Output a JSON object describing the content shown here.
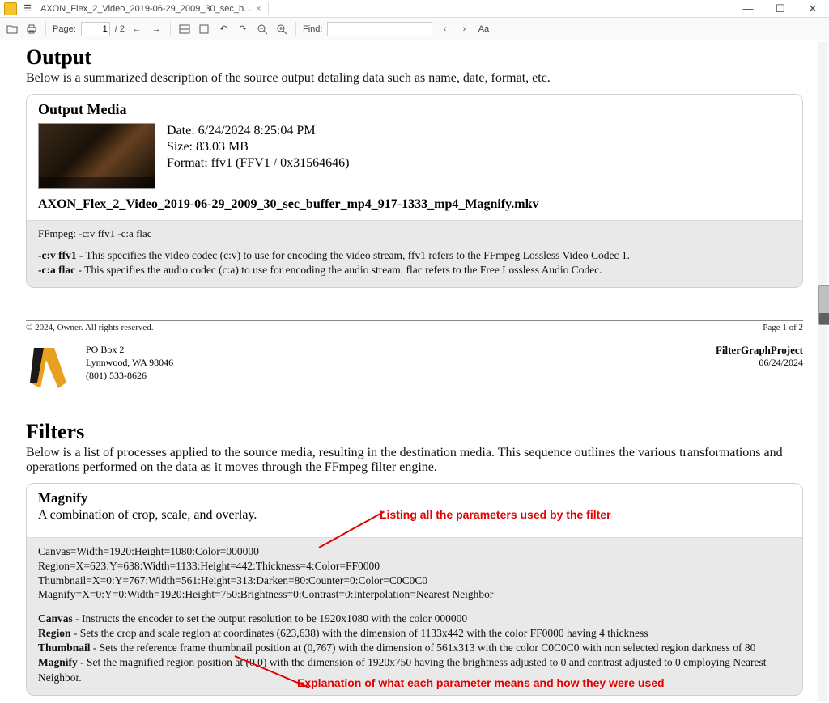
{
  "window": {
    "tab_title": "AXON_Flex_2_Video_2019-06-29_2009_30_sec_b…",
    "minimize": "—",
    "maximize": "☐",
    "close": "✕"
  },
  "toolbar": {
    "page_label": "Page:",
    "page_value": "1",
    "page_total": "/ 2",
    "find_label": "Find:",
    "find_value": ""
  },
  "output": {
    "heading": "Output",
    "sub": "Below is a summarized description of the source output detaling data such as name, date, format, etc.",
    "panel_title": "Output Media",
    "date": "Date: 6/24/2024 8:25:04 PM",
    "size": "Size: 83.03 MB",
    "format": "Format: ffv1 (FFV1 / 0x31564646)",
    "filename": "AXON_Flex_2_Video_2019-06-29_2009_30_sec_buffer_mp4_917-1333_mp4_Magnify.mkv",
    "ffmpeg": "FFmpeg: -c:v ffv1 -c:a flac",
    "expl_cv_b": "-c:v ffv1",
    "expl_cv_t": " - This specifies the video codec (c:v) to use for encoding the video stream, ffv1 refers to the FFmpeg Lossless Video Codec 1.",
    "expl_ca_b": "-c:a flac",
    "expl_ca_t": " - This specifies the audio codec (c:a) to use for encoding the audio stream. flac refers to the Free Lossless Audio Codec."
  },
  "footer": {
    "copyright": "© 2024, Owner. All rights reserved.",
    "page": "Page 1 of 2"
  },
  "header2": {
    "addr1": "PO Box 2",
    "addr2": "Lynnwood, WA 98046",
    "addr3": "(801) 533-8626",
    "project": "FilterGraphProject",
    "date": "06/24/2024"
  },
  "filters": {
    "heading": "Filters",
    "sub": "Below is a list of processes applied to the source media, resulting in the destination media. This sequence outlines the various transformations and operations performed on the data as it moves through the FFmpeg filter engine.",
    "panel_title": "Magnify",
    "panel_sub": "A combination of crop, scale, and overlay.",
    "p1": "Canvas=Width=1920:Height=1080:Color=000000",
    "p2": "Region=X=623:Y=638:Width=1133:Height=442:Thickness=4:Color=FF0000",
    "p3": "Thumbnail=X=0:Y=767:Width=561:Height=313:Darken=80:Counter=0:Color=C0C0C0",
    "p4": "Magnify=X=0:Y=0:Width=1920:Height=750:Brightness=0:Contrast=0:Interpolation=Nearest Neighbor",
    "e1b": "Canvas",
    "e1t": " - Instructs the encoder to set the output resolution to be 1920x1080 with the color 000000",
    "e2b": "Region",
    "e2t": " - Sets the crop and scale region at coordinates (623,638) with the dimension of 1133x442 with the color FF0000 having 4 thickness",
    "e3b": "Thumbnail",
    "e3t": " - Sets the reference frame thumbnail position at (0,767) with the dimension of 561x313 with the color C0C0C0 with non selected region darkness of 80",
    "e4b": "Magnify",
    "e4t": " - Set the magnified region position at (0,0) with the dimension of 1920x750 having the brightness adjusted to 0 and contrast adjusted to 0 employing Nearest Neighbor."
  },
  "annotations": {
    "top": "Listing all the parameters used by the filter",
    "bottom": "Explanation of what each parameter means and how they were used"
  }
}
